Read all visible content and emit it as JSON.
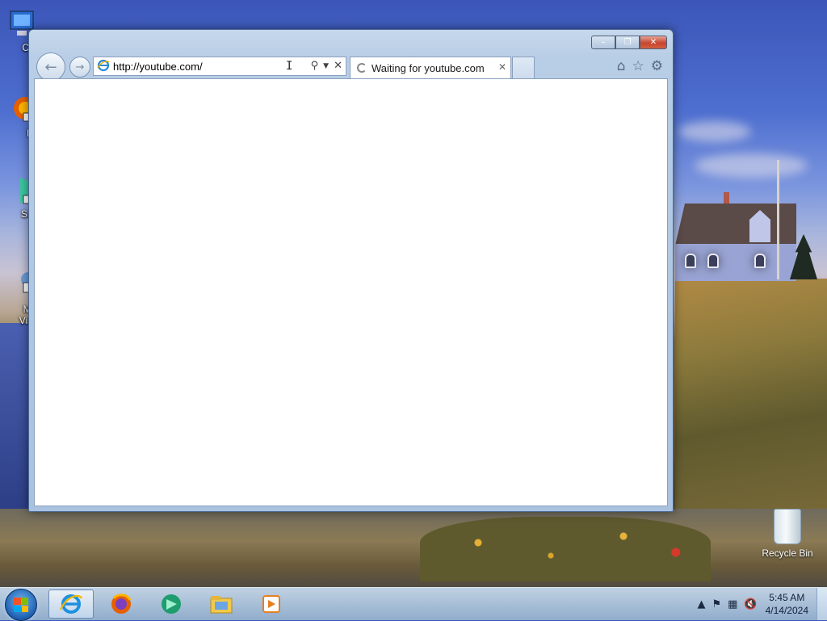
{
  "desktop": {
    "icons": [
      {
        "label": "Com",
        "icon": "computer-icon"
      },
      {
        "label": "Fir",
        "icon": "firefox-icon"
      },
      {
        "label": "Supe",
        "icon": "app-icon"
      },
      {
        "label": "Micr Visual",
        "icon": "visual-studio-icon"
      }
    ],
    "recycle_bin_label": "Recycle Bin"
  },
  "browser": {
    "address_value": "http://youtube.com/",
    "tab_title": "Waiting for youtube.com",
    "tab_close": "✕",
    "window_controls": {
      "minimize": "–",
      "restore": "❐",
      "close": "✕"
    }
  },
  "taskbar": {
    "pinned": [
      "internet-explorer-icon",
      "firefox-icon",
      "app-icon",
      "file-explorer-icon",
      "media-player-icon"
    ],
    "clock_time": "5:45 AM",
    "clock_date": "4/14/2024"
  }
}
